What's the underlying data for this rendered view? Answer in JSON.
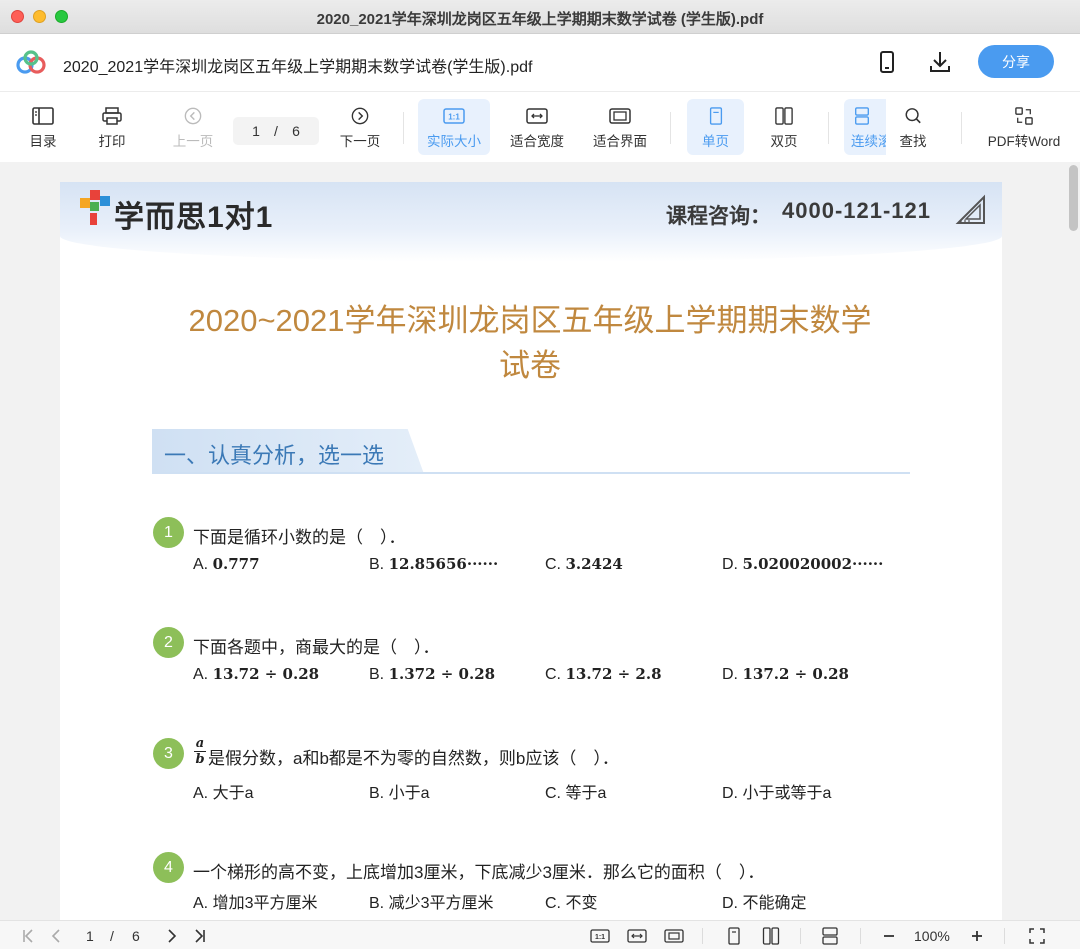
{
  "window": {
    "title": "2020_2021学年深圳龙岗区五年级上学期期末数学试卷 (学生版).pdf"
  },
  "header": {
    "doc_name": "2020_2021学年深圳龙岗区五年级上学期期末数学试卷(学生版).pdf",
    "share_label": "分享",
    "icons": [
      "app-logo-icon",
      "phone-icon",
      "download-icon"
    ]
  },
  "toolbar": {
    "toc": "目录",
    "print": "打印",
    "prev": "上一页",
    "page_current": "1",
    "page_sep": "/",
    "page_total": "6",
    "next": "下一页",
    "actual_size": "实际大小",
    "fit_width": "适合宽度",
    "fit_page": "适合界面",
    "single": "单页",
    "double": "双页",
    "continuous": "连续滚",
    "find": "查找",
    "pdf_to_word": "PDF转Word",
    "accent": "#4a9bf0"
  },
  "document": {
    "brand": "学而思1对1",
    "hotline_label": "课程咨询：",
    "hotline_number": "4000-121-121",
    "title_line1": "2020~2021学年深圳龙岗区五年级上学期期末数学",
    "title_line2": "试卷",
    "section1": "一、认真分析，选一选",
    "questions": [
      {
        "num": "1",
        "stem": "下面是循环小数的是（　）．",
        "options": [
          {
            "letter": "A.",
            "text": "0.777"
          },
          {
            "letter": "B.",
            "text": "12.85656······"
          },
          {
            "letter": "C.",
            "text": "3.2424"
          },
          {
            "letter": "D.",
            "text": "5.020020002······"
          }
        ]
      },
      {
        "num": "2",
        "stem": "下面各题中，商最大的是（　）．",
        "options": [
          {
            "letter": "A.",
            "text": "13.72 ÷ 0.28"
          },
          {
            "letter": "B.",
            "text": "1.372 ÷ 0.28"
          },
          {
            "letter": "C.",
            "text": "13.72 ÷ 2.8"
          },
          {
            "letter": "D.",
            "text": "137.2 ÷ 0.28"
          }
        ]
      },
      {
        "num": "3",
        "frac_num": "a",
        "frac_den": "b",
        "stem": "是假分数，a和b都是不为零的自然数，则b应该（　）．",
        "options": [
          {
            "letter": "A.",
            "text": "大于a"
          },
          {
            "letter": "B.",
            "text": "小于a"
          },
          {
            "letter": "C.",
            "text": "等于a"
          },
          {
            "letter": "D.",
            "text": "小于或等于a"
          }
        ]
      },
      {
        "num": "4",
        "stem": "一个梯形的高不变，上底增加3厘米，下底减少3厘米．那么它的面积（　）．",
        "options": [
          {
            "letter": "A.",
            "text": "增加3平方厘米"
          },
          {
            "letter": "B.",
            "text": "减少3平方厘米"
          },
          {
            "letter": "C.",
            "text": "不变"
          },
          {
            "letter": "D.",
            "text": "不能确定"
          }
        ]
      }
    ],
    "title_color": "#c0883f",
    "section_color": "#3b79b6",
    "badge_color": "#8dbf59"
  },
  "statusbar": {
    "page_current": "1",
    "page_sep": "/",
    "page_total": "6",
    "zoom": "100%"
  }
}
